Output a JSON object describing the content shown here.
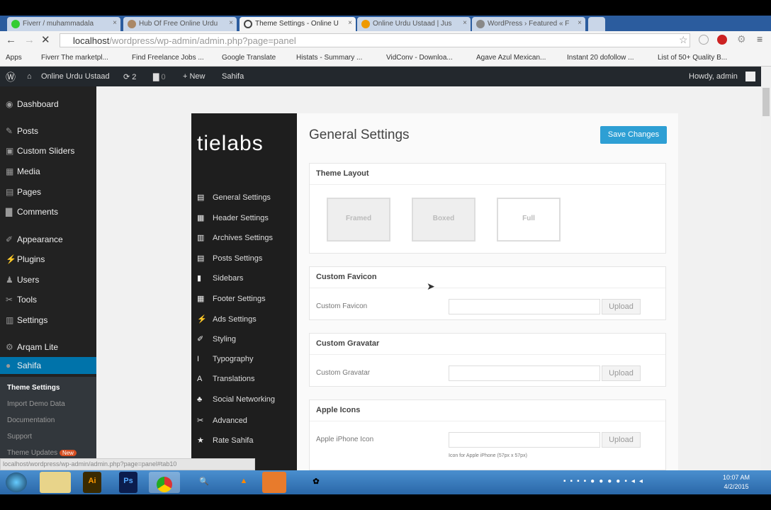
{
  "browser": {
    "tabs": [
      {
        "label": "Fiverr / muhammadala",
        "color": "#3c3"
      },
      {
        "label": "Hub Of Free Online Urdu",
        "color": "#a86"
      },
      {
        "label": "Theme Settings - Online U",
        "color": "#444",
        "active": true
      },
      {
        "label": "Online Urdu Ustaad | Jus",
        "color": "#e90"
      },
      {
        "label": "WordPress › Featured « F",
        "color": "#888"
      }
    ],
    "url_host": "localhost",
    "url_path": "/wordpress/wp-admin/admin.php?page=panel",
    "bookmarks": [
      "Apps",
      "Fiverr The marketpl...",
      "Find Freelance Jobs ...",
      "Google Translate",
      "Histats - Summary ...",
      "VidConv - Downloa...",
      "Agave Azul Mexican...",
      "Instant 20 dofollow ...",
      "List of 50+ Quality B..."
    ],
    "status_url": "localhost/wordpress/wp-admin/admin.php?page=panel#tab10"
  },
  "adminbar": {
    "site": "Online Urdu Ustaad",
    "updates": "2",
    "comments": "0",
    "new": "New",
    "theme": "Sahifa",
    "howdy": "Howdy, admin"
  },
  "sidebar": {
    "items": [
      {
        "label": "Dashboard",
        "icon": "dashboard-icon"
      },
      {
        "label": "Posts",
        "icon": "pin-icon"
      },
      {
        "label": "Custom Sliders",
        "icon": "slider-icon"
      },
      {
        "label": "Media",
        "icon": "media-icon"
      },
      {
        "label": "Pages",
        "icon": "page-icon"
      },
      {
        "label": "Comments",
        "icon": "comment-icon"
      },
      {
        "label": "Appearance",
        "icon": "brush-icon"
      },
      {
        "label": "Plugins",
        "icon": "plugin-icon"
      },
      {
        "label": "Users",
        "icon": "user-icon"
      },
      {
        "label": "Tools",
        "icon": "wrench-icon"
      },
      {
        "label": "Settings",
        "icon": "settings-icon"
      },
      {
        "label": "Arqam Lite",
        "icon": "gear-icon"
      },
      {
        "label": "Sahifa",
        "icon": "circle-icon"
      }
    ],
    "sub": [
      "Theme Settings",
      "Import Demo Data",
      "Documentation",
      "Support",
      "Theme Updates"
    ],
    "new_badge": "New"
  },
  "panel": {
    "logo": "tielabs",
    "nav": [
      "General Settings",
      "Header Settings",
      "Archives Settings",
      "Posts Settings",
      "Sidebars",
      "Footer Settings",
      "Ads Settings",
      "Styling",
      "Typography",
      "Translations",
      "Social Networking",
      "Advanced",
      "Rate Sahifa"
    ],
    "title": "General Settings",
    "save": "Save Changes",
    "layout_title": "Theme Layout",
    "layouts": [
      "Framed",
      "Boxed",
      "Full"
    ],
    "favicon_title": "Custom Favicon",
    "favicon_label": "Custom Favicon",
    "gravatar_title": "Custom Gravatar",
    "gravatar_label": "Custom Gravatar",
    "apple_title": "Apple Icons",
    "iphone_label": "Apple iPhone Icon",
    "iphone_hint": "Icon for Apple iPhone (57px x 57px)",
    "upload": "Upload"
  },
  "taskbar": {
    "time": "10:07 AM",
    "date": "4/2/2015",
    "apps": [
      "Ai",
      "Ps"
    ]
  }
}
